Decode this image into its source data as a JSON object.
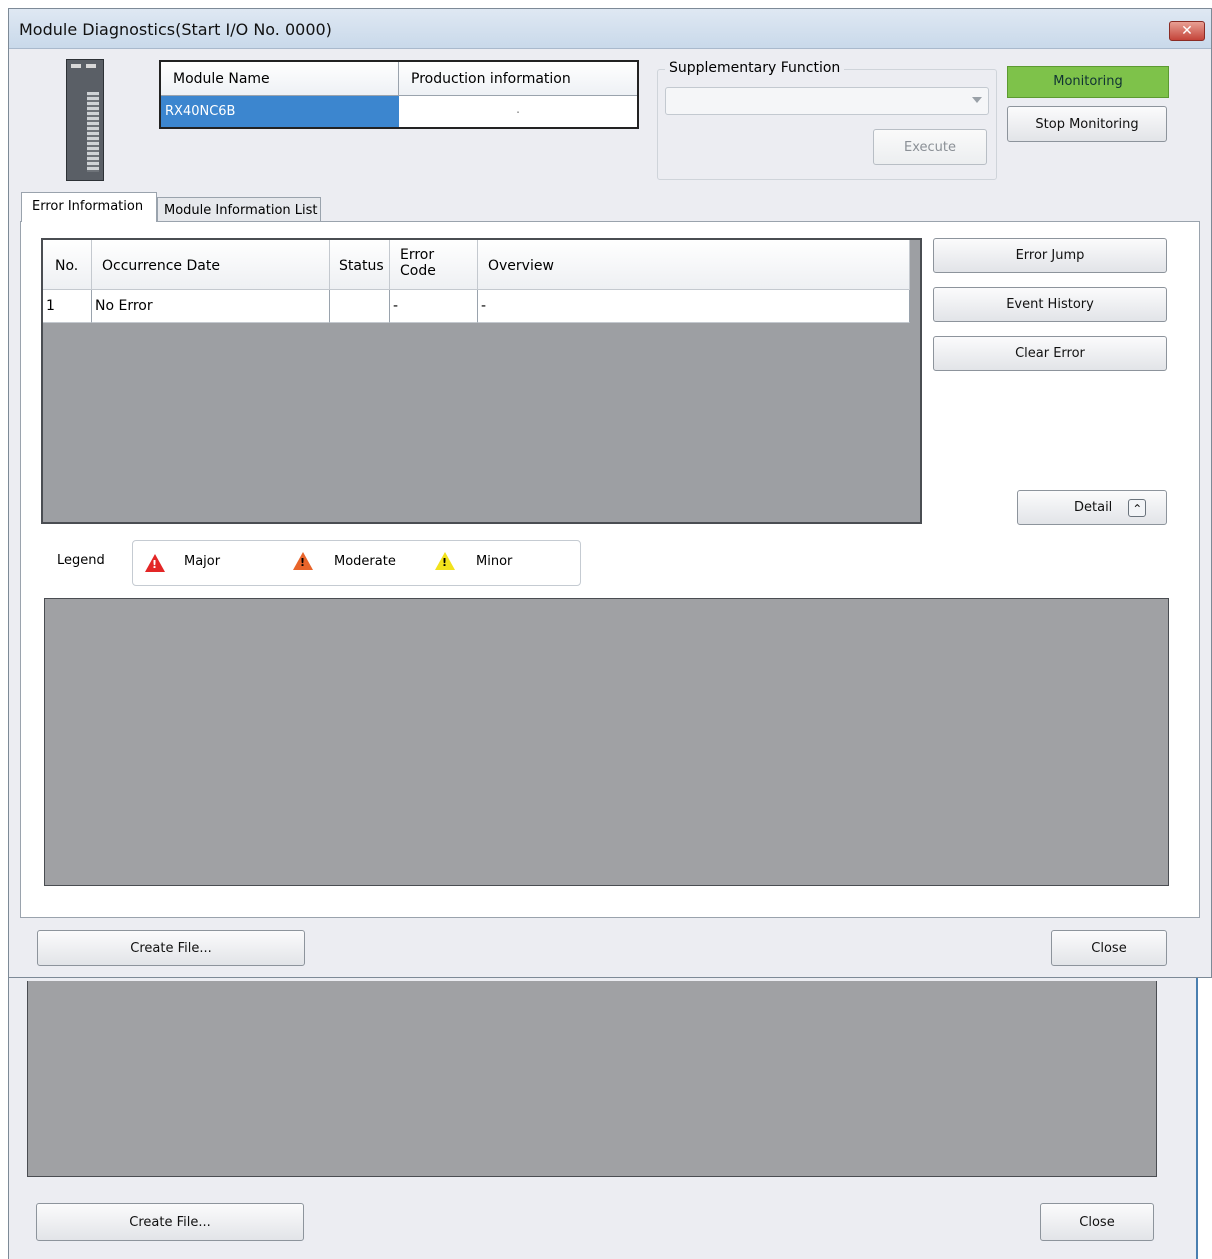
{
  "window": {
    "title": "Module Diagnostics(Start I/O No. 0000)",
    "close_glyph": "✕"
  },
  "module_table": {
    "headers": [
      "Module Name",
      "Production information"
    ],
    "row": {
      "module_name": "RX40NC6B",
      "production_info": "."
    }
  },
  "supplementary": {
    "label": "Supplementary Function",
    "selected_value": "",
    "execute_label": "Execute"
  },
  "monitoring": {
    "status": "Monitoring",
    "stop_label": "Stop Monitoring",
    "status_color": "#7ec24a"
  },
  "tabs": [
    {
      "label": "Error Information",
      "active": true
    },
    {
      "label": "Module Information List",
      "active": false
    }
  ],
  "error_table": {
    "headers": {
      "no": "No.",
      "occurrence_date": "Occurrence Date",
      "status": "Status",
      "error_code_line1": "Error",
      "error_code_line2": "Code",
      "overview": "Overview"
    },
    "rows": [
      {
        "no": "1",
        "occurrence_date": "No Error",
        "status": "",
        "error_code": "-",
        "overview": "-"
      }
    ]
  },
  "side_buttons": {
    "error_jump": "Error Jump",
    "event_history": "Event History",
    "clear_error": "Clear Error",
    "detail": "Detail",
    "detail_glyph": "⌃"
  },
  "legend": {
    "label": "Legend",
    "items": [
      {
        "label": "Major",
        "icon": "major-error-icon",
        "color": "#e32626"
      },
      {
        "label": "Moderate",
        "icon": "moderate-error-icon",
        "color": "#e8642a"
      },
      {
        "label": "Minor",
        "icon": "minor-error-icon",
        "color": "#f2e21c"
      }
    ],
    "icon_glyph": "!"
  },
  "bottom_buttons": {
    "create_file": "Create File...",
    "close": "Close"
  },
  "background_window": {
    "create_file": "Create File...",
    "close": "Close"
  }
}
